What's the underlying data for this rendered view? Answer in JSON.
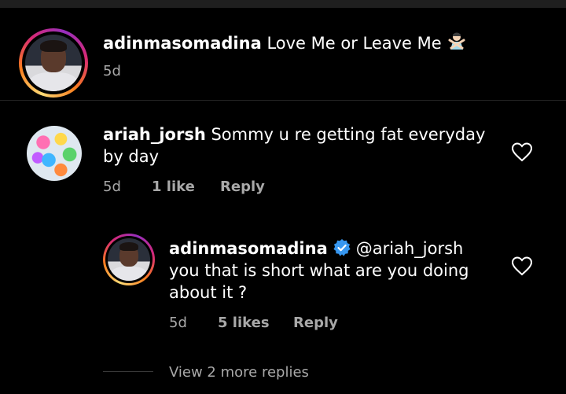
{
  "post": {
    "username": "adinmasomadina",
    "caption": "Love Me or Leave Me",
    "caption_emoji_icon": "person-gesturing-no-icon",
    "time": "5d"
  },
  "comment": {
    "username": "ariah_jorsh",
    "text_line1": "Sommy u re getting fat everyday",
    "text_line2": "by day",
    "time": "5d",
    "likes": "1 like",
    "reply_label": "Reply"
  },
  "reply": {
    "username": "adinmasomadina",
    "verified_icon": "verified-badge-icon",
    "mention": "@ariah_jorsh",
    "text_line1": "you that is short what are you doing",
    "text_line2": "about it ?",
    "time": "5d",
    "likes": "5 likes",
    "reply_label": "Reply"
  },
  "view_more": "View 2 more replies",
  "colors": {
    "background": "#000000",
    "text": "#ffffff",
    "secondary_text": "#a8a8a8",
    "verified": "#3797f0"
  }
}
